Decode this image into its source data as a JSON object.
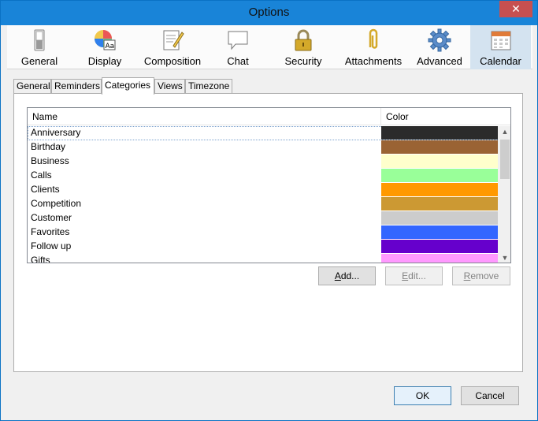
{
  "window": {
    "title": "Options",
    "close_glyph": "✕"
  },
  "toolbar": {
    "items": [
      {
        "label": "General",
        "icon": "switch-icon"
      },
      {
        "label": "Display",
        "icon": "color-wheel-icon"
      },
      {
        "label": "Composition",
        "icon": "document-pencil-icon"
      },
      {
        "label": "Chat",
        "icon": "speech-bubble-icon"
      },
      {
        "label": "Security",
        "icon": "padlock-icon"
      },
      {
        "label": "Attachments",
        "icon": "paperclip-icon"
      },
      {
        "label": "Advanced",
        "icon": "gear-icon"
      },
      {
        "label": "Calendar",
        "icon": "calendar-icon"
      }
    ],
    "active": "Calendar"
  },
  "subtabs": {
    "items": [
      "General",
      "Reminders",
      "Categories",
      "Views",
      "Timezone"
    ],
    "active": "Categories"
  },
  "categories": {
    "columns": {
      "name": "Name",
      "color": "Color"
    },
    "rows": [
      {
        "name": "Anniversary",
        "color": "#2b2b2b"
      },
      {
        "name": "Birthday",
        "color": "#9a6334"
      },
      {
        "name": "Business",
        "color": "#ffffcc"
      },
      {
        "name": "Calls",
        "color": "#99ff99"
      },
      {
        "name": "Clients",
        "color": "#ff9900"
      },
      {
        "name": "Competition",
        "color": "#cc9933"
      },
      {
        "name": "Customer",
        "color": "#cccccc"
      },
      {
        "name": "Favorites",
        "color": "#3366ff"
      },
      {
        "name": "Follow up",
        "color": "#6600cc"
      },
      {
        "name": "Gifts",
        "color": "#ff99ff"
      }
    ],
    "selected": "Anniversary"
  },
  "buttons": {
    "add": {
      "prefix": "",
      "accel": "A",
      "rest": "dd..."
    },
    "edit": {
      "prefix": "",
      "accel": "E",
      "rest": "dit..."
    },
    "remove": {
      "prefix": "",
      "accel": "R",
      "rest": "emove"
    },
    "ok": "OK",
    "cancel": "Cancel"
  },
  "colors": {
    "titlebar": "#1984d8",
    "active_tab": "#d4e3f0",
    "close": "#c75050"
  }
}
